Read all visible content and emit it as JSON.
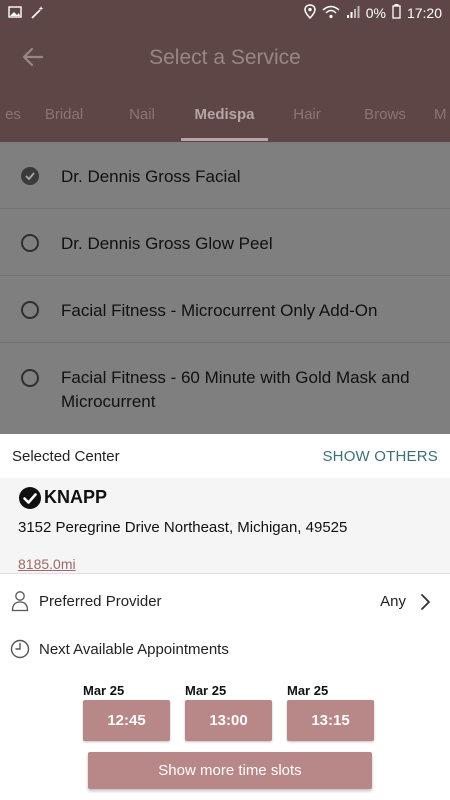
{
  "status_bar": {
    "battery_percent": "0%",
    "time": "17:20",
    "icons": [
      "image-icon",
      "magic-wand-icon",
      "location-icon",
      "wifi-icon",
      "signal-icon",
      "battery-icon"
    ]
  },
  "app_bar": {
    "title": "Select a Service",
    "back_icon": "back-arrow-icon"
  },
  "tabs": [
    {
      "label": "es"
    },
    {
      "label": "Bridal"
    },
    {
      "label": "Nail"
    },
    {
      "label": "Medispa",
      "active": true
    },
    {
      "label": "Hair"
    },
    {
      "label": "Brows"
    },
    {
      "label": "M"
    }
  ],
  "services": [
    {
      "label": "Dr. Dennis Gross Facial",
      "selected": true
    },
    {
      "label": "Dr. Dennis Gross Glow Peel",
      "selected": false
    },
    {
      "label": "Facial Fitness -  Microcurrent Only Add-On",
      "selected": false
    },
    {
      "label": "Facial Fitness - 60 Minute with Gold Mask and Microcurrent",
      "selected": false
    }
  ],
  "sheet": {
    "title": "Selected Center",
    "show_others": "SHOW OTHERS",
    "center": {
      "name": "KNAPP",
      "address": "3152 Peregrine Drive Northeast, Michigan, 49525",
      "distance": "8185.0mi"
    },
    "preferred_provider": {
      "label": "Preferred Provider",
      "value": "Any"
    },
    "next_available": {
      "label": "Next Available Appointments"
    },
    "slots": [
      {
        "date": "Mar 25",
        "time": "12:45"
      },
      {
        "date": "Mar 25",
        "time": "13:00"
      },
      {
        "date": "Mar 25",
        "time": "13:15"
      }
    ],
    "show_more": "Show more time slots"
  },
  "colors": {
    "header_bg": "#5f4646",
    "overlay_bg": "#7f7f7f",
    "accent_button": "#b88787",
    "link_teal": "#3e6e76",
    "distance_link": "#9c6a6a"
  }
}
